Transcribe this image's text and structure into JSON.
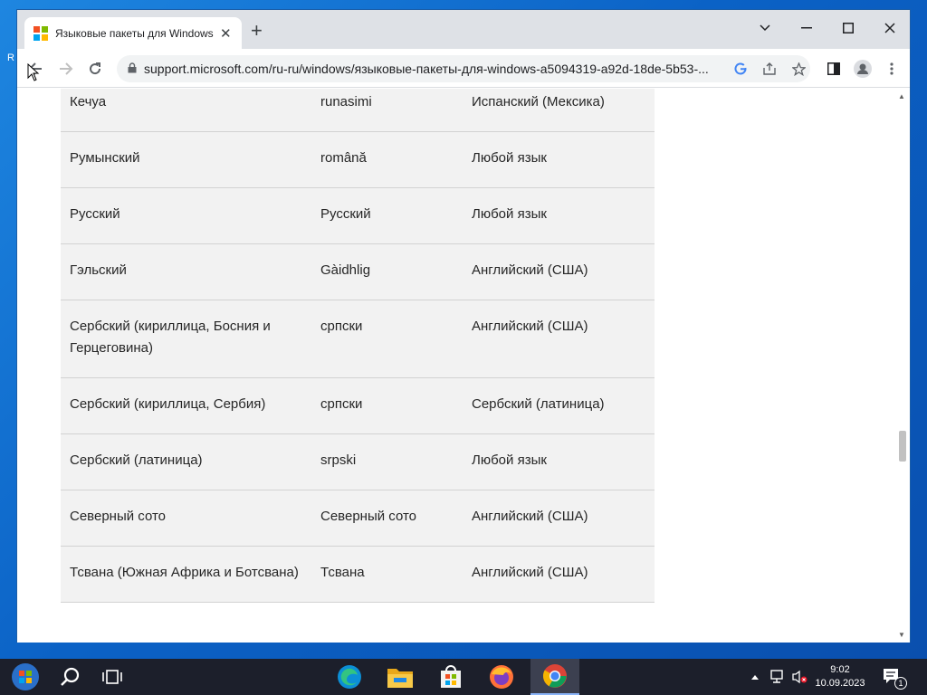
{
  "desktop": {
    "fragment": "R"
  },
  "browser": {
    "tab_title": "Языковые пакеты для Windows",
    "url": "support.microsoft.com/ru-ru/windows/языковые-пакеты-для-windows-a5094319-a92d-18de-5b53-..."
  },
  "icons": {
    "window_logo": "windows-logo-icon",
    "close": "close-icon",
    "new_tab": "plus-icon",
    "back": "back-arrow-icon",
    "forward": "forward-arrow-icon",
    "reload": "reload-icon",
    "lock": "lock-icon",
    "google": "google-icon",
    "share": "share-icon",
    "bookmark": "star-icon",
    "sidebar": "side-panel-icon",
    "profile": "profile-icon",
    "menu": "kebab-menu-icon"
  },
  "languages": [
    {
      "name": "Кечуа",
      "native": "runasimi",
      "base": "Испанский (Мексика)"
    },
    {
      "name": "Румынский",
      "native": "română",
      "base": "Любой язык"
    },
    {
      "name": "Русский",
      "native": "Русский",
      "base": "Любой язык"
    },
    {
      "name": "Гэльский",
      "native": "Gàidhlig",
      "base": "Английский (США)"
    },
    {
      "name": "Сербский (кириллица, Босния и Герцеговина)",
      "native": "српски",
      "base": "Английский (США)"
    },
    {
      "name": "Сербский (кириллица, Сербия)",
      "native": "српски",
      "base": "Сербский (латиница)"
    },
    {
      "name": "Сербский (латиница)",
      "native": "srpski",
      "base": "Любой язык"
    },
    {
      "name": "Северный сото",
      "native": "Северный сото",
      "base": "Английский (США)"
    },
    {
      "name": "Тсвана (Южная Африка и Ботсвана)",
      "native": "Тсвана",
      "base": "Английский (США)"
    }
  ],
  "taskbar": {
    "time": "9:02",
    "date": "10.09.2023",
    "notification_count": "1"
  },
  "colors": {
    "win_red": "#f25022",
    "win_green": "#7fba00",
    "win_blue": "#00a4ef",
    "win_yellow": "#ffb900",
    "table_bg": "#f2f2f2",
    "taskbar_bg": "#1c1f2b"
  }
}
